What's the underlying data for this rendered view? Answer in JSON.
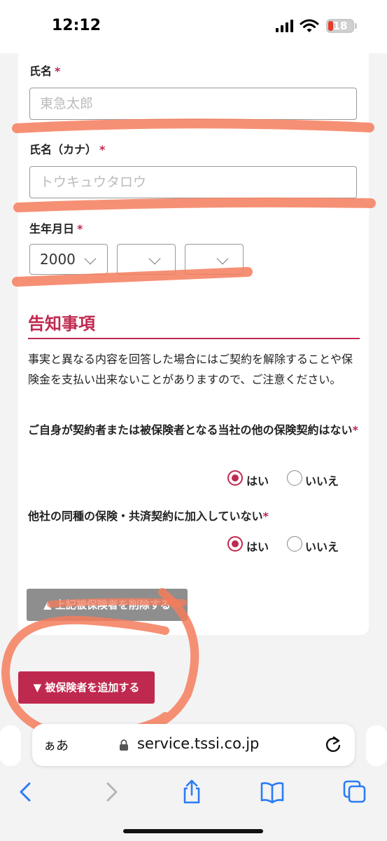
{
  "status_bar": {
    "time": "12:12",
    "battery": "18"
  },
  "form": {
    "name_label": "氏名",
    "name_placeholder": "東急太郎",
    "kana_label": "氏名（カナ）",
    "kana_placeholder": "トウキュウタロウ",
    "birth_label": "生年月日",
    "birth_year": "2000",
    "birth_month": "",
    "birth_day": "",
    "required_mark": "*"
  },
  "notice": {
    "title": "告知事項",
    "description": "事実と異なる内容を回答した場合にはご契約を解除することや保険金を支払い出来ないことがありますので、ご注意ください。",
    "q1": "ご自身が契約者または被保険者となる当社の他の保険契約はない",
    "q2": "他社の同種の保険・共済契約に加入していない",
    "yes": "はい",
    "no": "いいえ",
    "q1_answer": "はい",
    "q2_answer": "はい"
  },
  "buttons": {
    "delete_insured": "▲ 上記被保険者を削除する",
    "add_insured": "▼ 被保険者を追加する"
  },
  "browser": {
    "text_size": "ぁあ",
    "url": "service.tssi.co.jp"
  },
  "colors": {
    "accent": "#c0294f",
    "annotation": "#f47c5c"
  },
  "icons": [
    "signal-icon",
    "wifi-icon",
    "battery-icon",
    "lock-icon",
    "reload-icon",
    "back-icon",
    "forward-icon",
    "share-icon",
    "bookmarks-icon",
    "tabs-icon",
    "chevron-down-icon"
  ]
}
